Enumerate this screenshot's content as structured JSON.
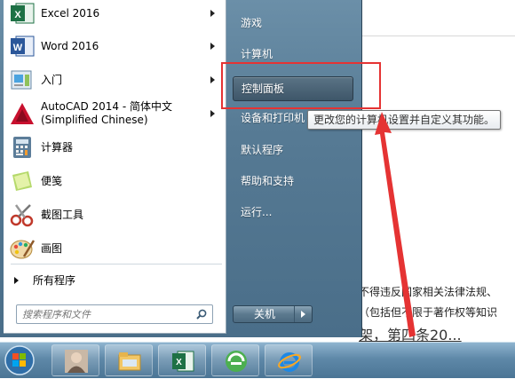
{
  "start_menu": {
    "programs": [
      {
        "label": "Excel 2016",
        "icon": "excel-icon",
        "has_submenu": true
      },
      {
        "label": "Word 2016",
        "icon": "word-icon",
        "has_submenu": true
      },
      {
        "label": "入门",
        "icon": "getting-started-icon",
        "has_submenu": true
      },
      {
        "label": "AutoCAD 2014 - 简体中文\n(Simplified Chinese)",
        "icon": "autocad-icon",
        "has_submenu": true
      },
      {
        "label": "计算器",
        "icon": "calculator-icon",
        "has_submenu": false
      },
      {
        "label": "便笺",
        "icon": "sticky-notes-icon",
        "has_submenu": false
      },
      {
        "label": "截图工具",
        "icon": "snipping-tool-icon",
        "has_submenu": false
      },
      {
        "label": "画图",
        "icon": "paint-icon",
        "has_submenu": false
      }
    ],
    "all_programs_label": "所有程序",
    "search_placeholder": "搜索程序和文件",
    "right_items": [
      {
        "label": "游戏"
      },
      {
        "label": "计算机"
      },
      {
        "label": "控制面板"
      },
      {
        "label": "设备和打印机"
      },
      {
        "label": "默认程序"
      },
      {
        "label": "帮助和支持"
      },
      {
        "label": "运行..."
      }
    ],
    "shutdown_label": "关机",
    "tooltip": "更改您的计算机设置并自定义其功能。"
  },
  "background_document": {
    "line1": "不得违反国家相关法律法规、",
    "line2": "（包括但不限于著作权等知识",
    "line3": "架，第四条20..."
  },
  "taskbar": {
    "items": [
      "start-orb-icon",
      "user-photo-icon",
      "file-explorer-icon",
      "excel-icon",
      "360-browser-icon",
      "internet-explorer-icon"
    ]
  },
  "colors": {
    "annotation_red": "#e53333",
    "menu_blue": "#567a94"
  }
}
